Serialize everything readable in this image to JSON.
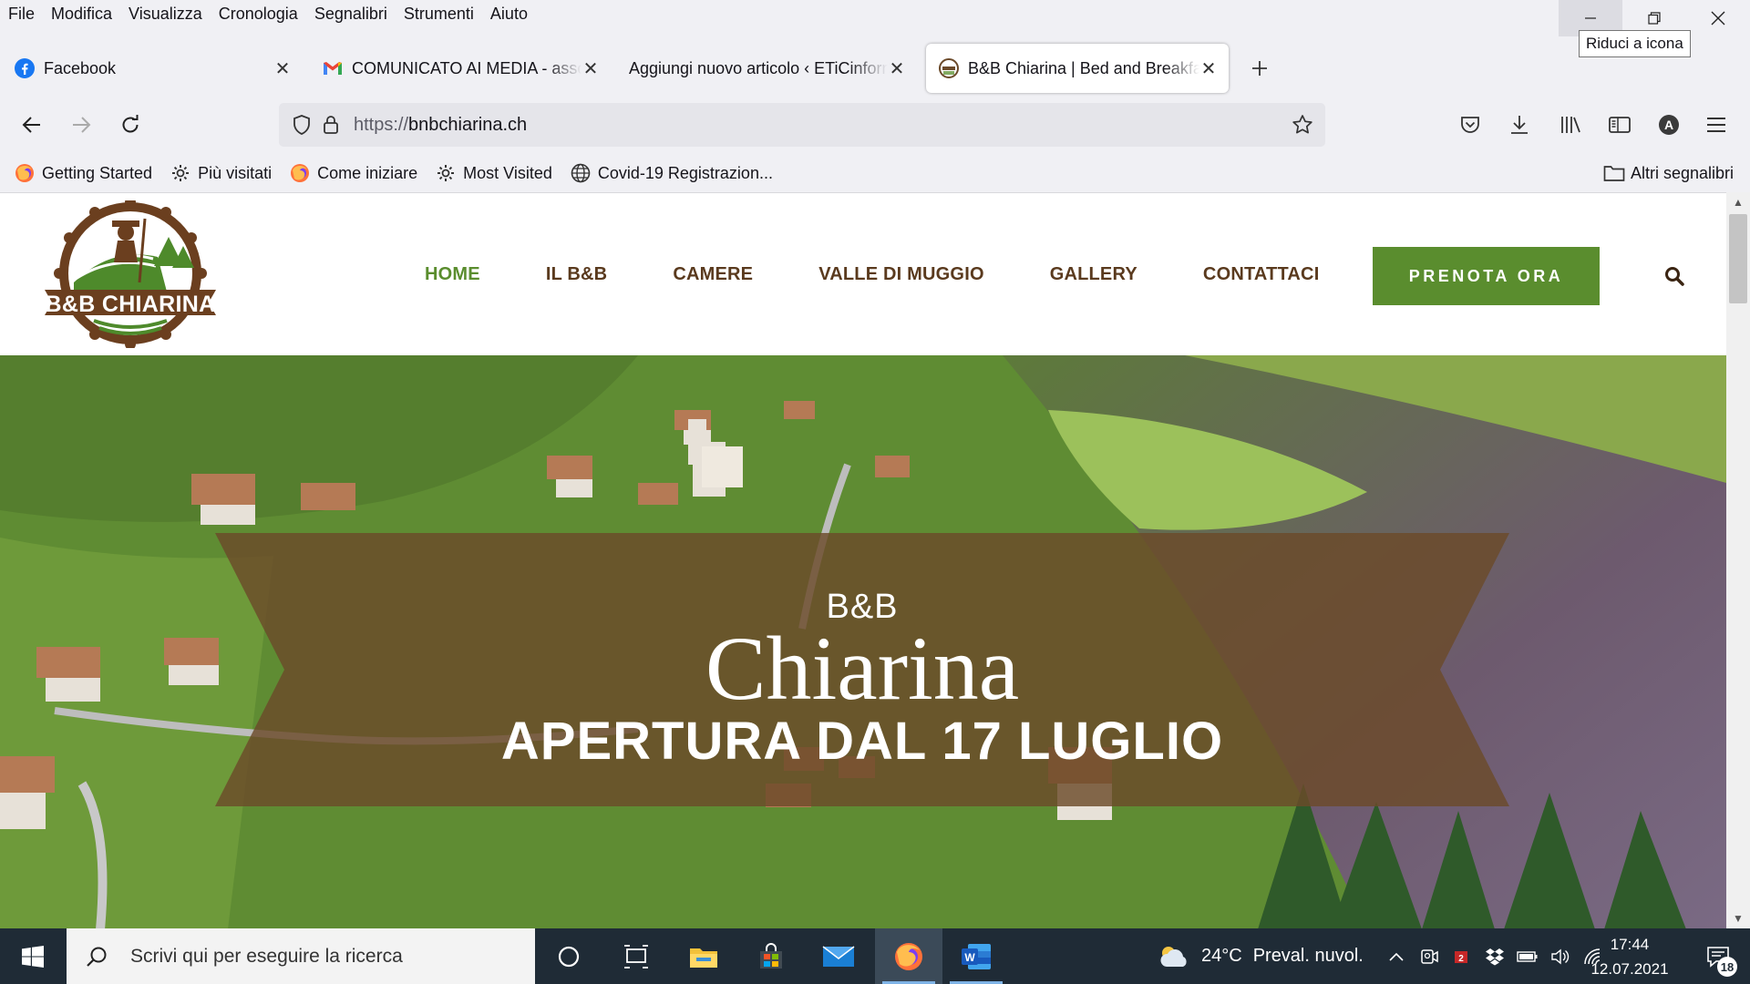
{
  "menu": [
    "File",
    "Modifica",
    "Visualizza",
    "Cronologia",
    "Segnalibri",
    "Strumenti",
    "Aiuto"
  ],
  "window": {
    "tooltip": "Riduci a icona"
  },
  "tabs": [
    {
      "title": "Facebook",
      "icon": "facebook-icon",
      "active": false
    },
    {
      "title": "COMUNICATO AI MEDIA - associazione",
      "icon": "gmail-icon",
      "active": false
    },
    {
      "title": "Aggiungi nuovo articolo ‹ ETiCinformazione",
      "icon": "none",
      "active": false
    },
    {
      "title": "B&B Chiarina | Bed and Breakfast",
      "icon": "chiarina-favicon",
      "active": true
    }
  ],
  "url": {
    "scheme": "https://",
    "host": "bnbchiarina.ch"
  },
  "bookmarks": [
    {
      "label": "Getting Started",
      "icon": "firefox-icon"
    },
    {
      "label": "Più visitati",
      "icon": "gear-icon"
    },
    {
      "label": "Come iniziare",
      "icon": "firefox-icon"
    },
    {
      "label": "Most Visited",
      "icon": "gear-icon"
    },
    {
      "label": "Covid-19 Registrazion...",
      "icon": "globe-icon"
    }
  ],
  "other_bookmarks": "Altri segnalibri",
  "site": {
    "logo_text": "B&B CHIARINA",
    "nav": [
      "HOME",
      "IL B&B",
      "CAMERE",
      "VALLE DI MUGGIO",
      "GALLERY",
      "CONTATTACI"
    ],
    "active_nav": "HOME",
    "cta": "PRENOTA ORA",
    "hero_small": "B&B",
    "hero_big": "Chiarina",
    "hero_sub": "APERTURA DAL 17 LUGLIO",
    "colors": {
      "green": "#5a8d2e",
      "brown": "#5a3a1e",
      "banner": "#6b4a2a"
    }
  },
  "taskbar": {
    "search_placeholder": "Scrivi qui per eseguire la ricerca",
    "weather_temp": "24°C",
    "weather_desc": "Preval. nuvol.",
    "time": "17:44",
    "date": "12.07.2021",
    "notifications": "18",
    "pinned": [
      "cortana-icon",
      "task-view-icon",
      "file-explorer-icon",
      "store-icon",
      "mail-icon",
      "firefox-icon",
      "word-icon"
    ]
  }
}
